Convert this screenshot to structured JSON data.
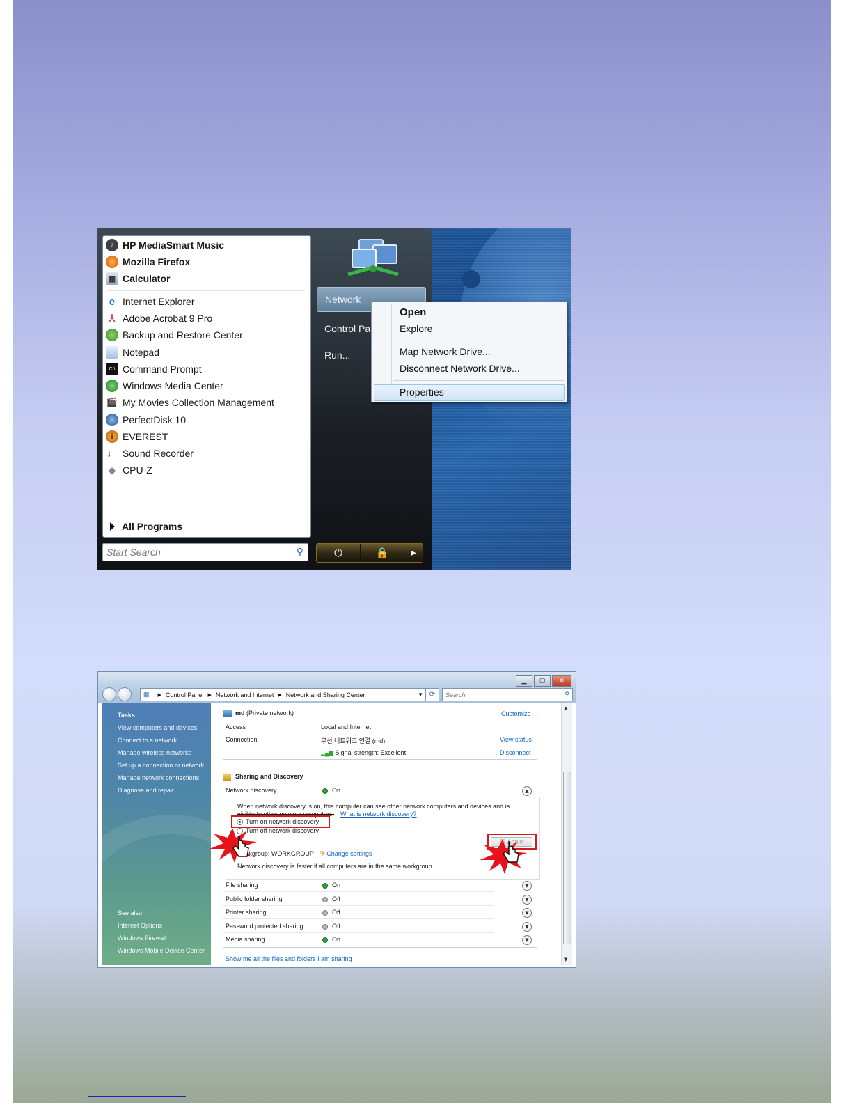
{
  "start_menu": {
    "pinned_items": [
      {
        "label": "HP MediaSmart Music",
        "icon": "hp-mediasmart-icon"
      },
      {
        "label": "Mozilla Firefox",
        "icon": "firefox-icon"
      },
      {
        "label": "Calculator",
        "icon": "calculator-icon"
      }
    ],
    "recent_items": [
      {
        "label": "Internet Explorer",
        "icon": "internet-explorer-icon"
      },
      {
        "label": "Adobe Acrobat 9 Pro",
        "icon": "acrobat-icon"
      },
      {
        "label": "Backup and Restore Center",
        "icon": "backup-icon"
      },
      {
        "label": "Notepad",
        "icon": "notepad-icon"
      },
      {
        "label": "Command Prompt",
        "icon": "command-prompt-icon"
      },
      {
        "label": "Windows Media Center",
        "icon": "media-center-icon"
      },
      {
        "label": "My Movies Collection Management",
        "icon": "movies-icon"
      },
      {
        "label": "PerfectDisk 10",
        "icon": "perfectdisk-icon"
      },
      {
        "label": "EVEREST",
        "icon": "everest-icon"
      },
      {
        "label": "Sound Recorder",
        "icon": "sound-recorder-icon"
      },
      {
        "label": "CPU-Z",
        "icon": "cpuz-icon"
      }
    ],
    "all_programs": "All Programs",
    "search_placeholder": "Start Search",
    "right_items": {
      "network": "Network",
      "control_panel": "Control Pa",
      "run": "Run..."
    },
    "context_menu": {
      "open": "Open",
      "explore": "Explore",
      "map_drive": "Map Network Drive...",
      "disconnect_drive": "Disconnect Network Drive...",
      "properties": "Properties"
    }
  },
  "network_center": {
    "breadcrumb": [
      "Control Panel",
      "Network and Internet",
      "Network and Sharing Center"
    ],
    "search_placeholder": "Search",
    "tasks": {
      "title": "Tasks",
      "items": [
        "View computers and devices",
        "Connect to a network",
        "Manage wireless networks",
        "Set up a connection or network",
        "Manage network connections",
        "Diagnose and repair"
      ]
    },
    "see_also": {
      "title": "See also",
      "items": [
        "Internet Options",
        "Windows Firewall",
        "Windows Mobile Device Center"
      ]
    },
    "network": {
      "name": "md",
      "type": "(Private network)",
      "customize": "Customize",
      "access_label": "Access",
      "access_value": "Local and Internet",
      "connection_label": "Connection",
      "connection_value": "무선 네트워크 연결 (md)",
      "view_status": "View status",
      "signal_label": "Signal strength:",
      "signal_value": "Excellent",
      "disconnect": "Disconnect"
    },
    "sharing": {
      "title": "Sharing and Discovery",
      "network_discovery_label": "Network discovery",
      "network_discovery_value": "On",
      "description_line1": "When network discovery is on, this computer can see other network computers and devices and is",
      "description_line2": "visible to other network computers.",
      "what_is_link": "What is network discovery?",
      "turn_on": "Turn on network discovery",
      "turn_off": "Turn off network discovery",
      "apply": "Apply",
      "workgroup": "Workgroup: WORKGROUP",
      "change_settings": "Change settings",
      "workgroup_note": "Network discovery is faster if all computers are in the same workgroup.",
      "rows": [
        {
          "label": "File sharing",
          "value": "On",
          "status": "on"
        },
        {
          "label": "Public folder sharing",
          "value": "Off",
          "status": "off"
        },
        {
          "label": "Printer sharing",
          "value": "Off",
          "status": "off"
        },
        {
          "label": "Password protected sharing",
          "value": "Off",
          "status": "off"
        },
        {
          "label": "Media sharing",
          "value": "On",
          "status": "on"
        }
      ],
      "show_files_link": "Show me all the files and folders I am sharing"
    }
  },
  "colors": {
    "highlight_red": "#d41a1a",
    "link_blue": "#1466c6",
    "status_green": "#2ea82e"
  }
}
